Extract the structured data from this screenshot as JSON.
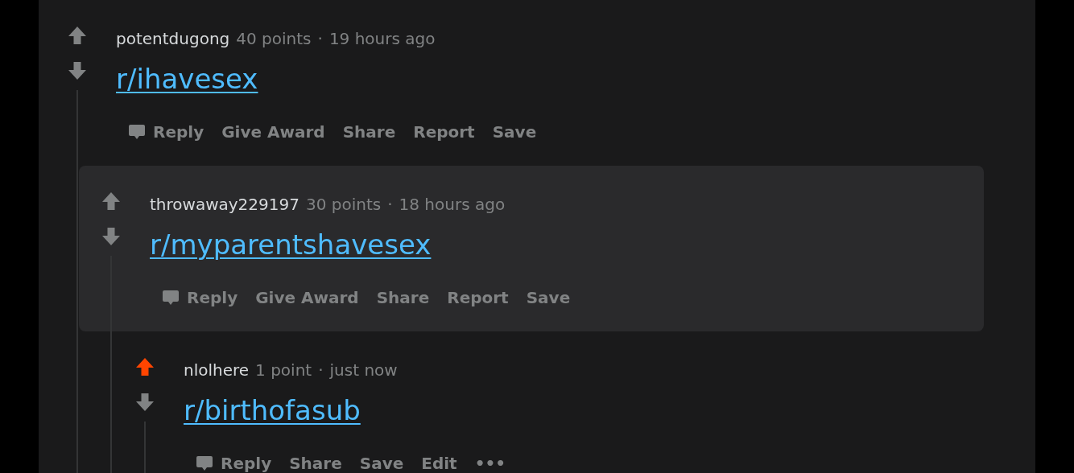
{
  "comments": [
    {
      "username": "potentdugong",
      "points": "40 points",
      "separator": "·",
      "time": "19 hours ago",
      "link": "r/ihavesex",
      "upvoted": false,
      "highlighted": false,
      "actions": [
        {
          "label": "Reply",
          "kind": "reply"
        },
        {
          "label": "Give Award",
          "kind": "text"
        },
        {
          "label": "Share",
          "kind": "text"
        },
        {
          "label": "Report",
          "kind": "text"
        },
        {
          "label": "Save",
          "kind": "text"
        }
      ],
      "children": [
        {
          "username": "throwaway229197",
          "points": "30 points",
          "separator": "·",
          "time": "18 hours ago",
          "link": "r/myparentshavesex",
          "upvoted": false,
          "highlighted": true,
          "actions": [
            {
              "label": "Reply",
              "kind": "reply"
            },
            {
              "label": "Give Award",
              "kind": "text"
            },
            {
              "label": "Share",
              "kind": "text"
            },
            {
              "label": "Report",
              "kind": "text"
            },
            {
              "label": "Save",
              "kind": "text"
            }
          ],
          "children": [
            {
              "username": "nlolhere",
              "points": "1 point",
              "separator": "·",
              "time": "just now",
              "link": "r/birthofasub",
              "upvoted": true,
              "highlighted": false,
              "actions": [
                {
                  "label": "Reply",
                  "kind": "reply"
                },
                {
                  "label": "Share",
                  "kind": "text"
                },
                {
                  "label": "Save",
                  "kind": "text"
                },
                {
                  "label": "Edit",
                  "kind": "text"
                },
                {
                  "label": "•••",
                  "kind": "more"
                }
              ]
            }
          ]
        }
      ]
    }
  ]
}
